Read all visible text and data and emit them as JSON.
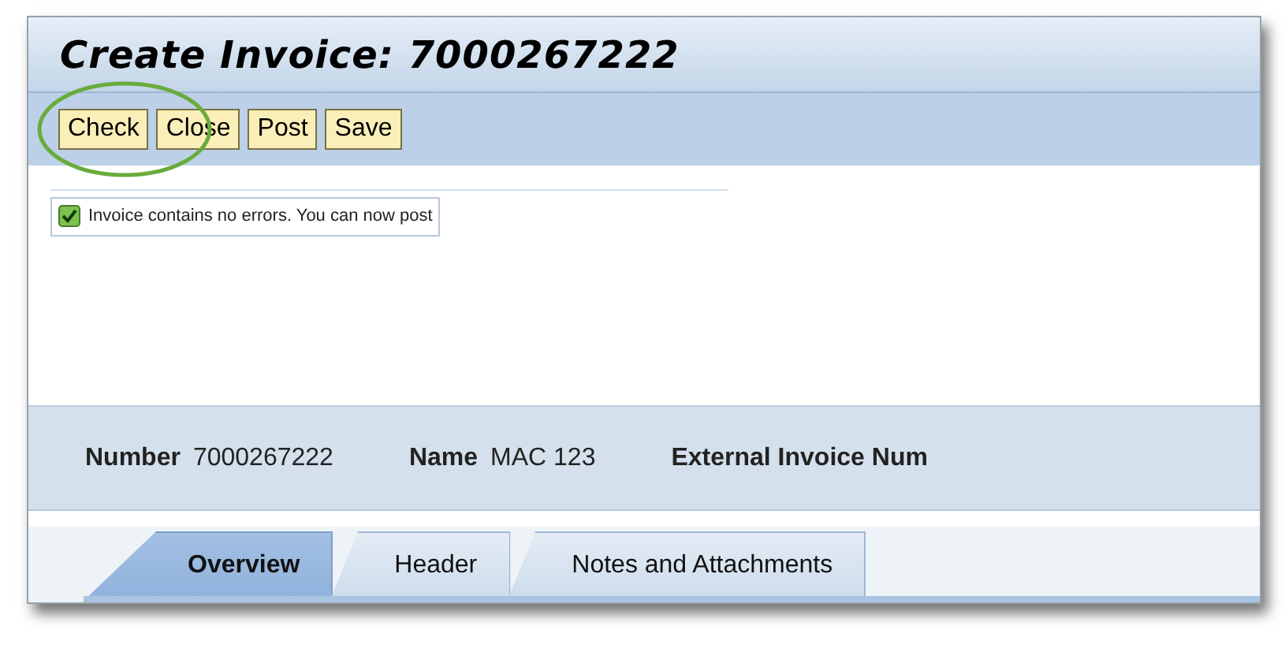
{
  "window": {
    "title": "Create Invoice: 7000267222"
  },
  "toolbar": {
    "buttons": [
      {
        "label": "Check",
        "highlighted": true
      },
      {
        "label": "Close",
        "highlighted": false
      },
      {
        "label": "Post",
        "highlighted": false
      },
      {
        "label": "Save",
        "highlighted": false
      }
    ]
  },
  "message": {
    "kind": "success",
    "text": "Invoice contains no errors. You can now post"
  },
  "header_fields": [
    {
      "label": "Number",
      "value": "7000267222"
    },
    {
      "label": "Name",
      "value": "MAC 123"
    },
    {
      "label": "External Invoice Num"
    }
  ],
  "tabs": [
    {
      "label": "Overview",
      "selected": true
    },
    {
      "label": "Header",
      "selected": false
    },
    {
      "label": "Notes and Attachments",
      "selected": false
    }
  ]
}
